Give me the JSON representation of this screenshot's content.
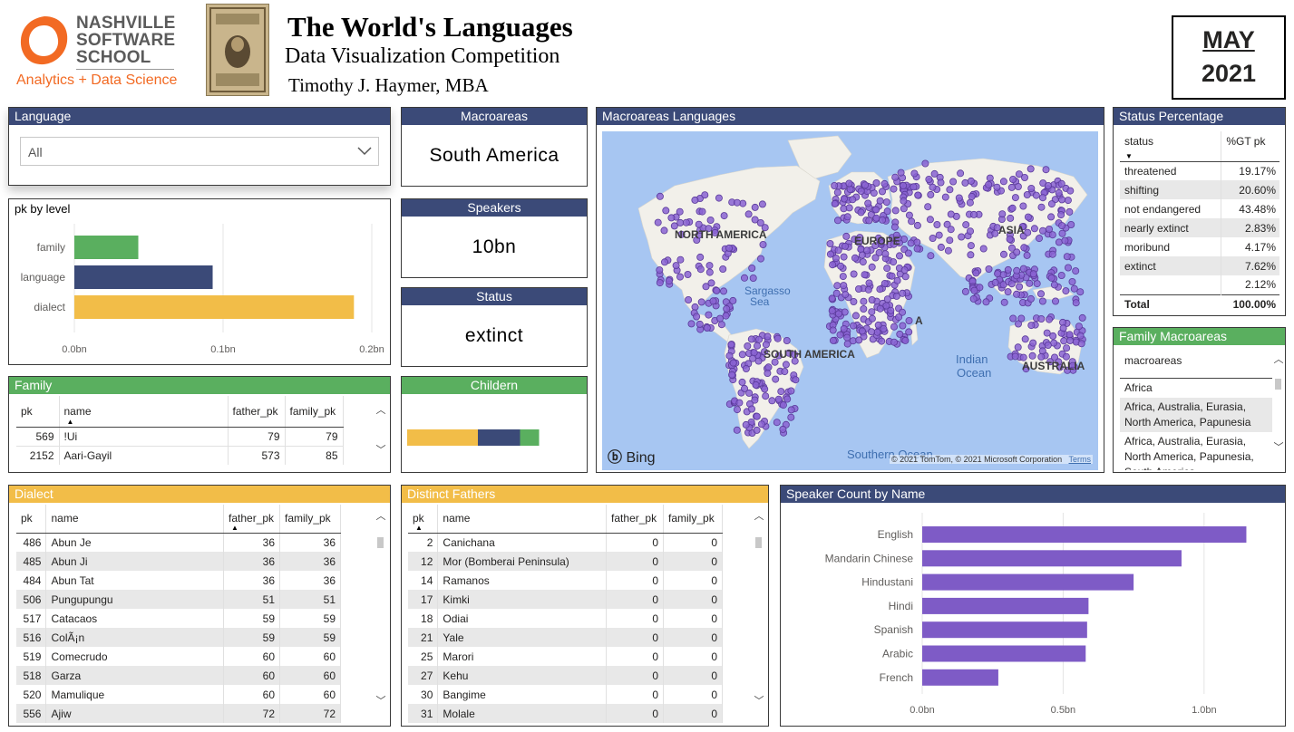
{
  "header": {
    "logo_line1": "NASHVILLE",
    "logo_line2": "SOFTWARE",
    "logo_line3": "SCHOOL",
    "logo_tagline": "Analytics + Data Science",
    "title": "The World's Languages",
    "subtitle": "Data Visualization Competition",
    "author": "Timothy J. Haymer, MBA",
    "month": "MAY",
    "year": "2021"
  },
  "language_slicer": {
    "title": "Language",
    "value": "All"
  },
  "kpis": {
    "macroareas": {
      "title": "Macroareas",
      "value": "South America"
    },
    "speakers": {
      "title": "Speakers",
      "value": "10bn"
    },
    "status": {
      "title": "Status",
      "value": "extinct"
    },
    "children": {
      "title": "Childern"
    }
  },
  "pk_by_level": {
    "title": "pk by level",
    "ticks": [
      "0.0bn",
      "0.1bn",
      "0.2bn"
    ]
  },
  "map": {
    "title": "Macroareas Languages",
    "labels": {
      "north_america": "NORTH AMERICA",
      "europe": "EUROPE",
      "asia": "ASIA",
      "south_america": "SOUTH AMERICA",
      "sargasso": "Sargasso",
      "sea": "Sea",
      "indian": "Indian",
      "ocean": "Ocean",
      "southern_ocean": "Southern Ocean",
      "africa": "A",
      "australia": "AUSTRALIA"
    },
    "bing": "Bing",
    "copyright": "© 2021 TomTom, © 2021 Microsoft Corporation",
    "terms": "Terms"
  },
  "status_percentage": {
    "title": "Status Percentage",
    "col1": "status",
    "col2": "%GT pk",
    "rows": [
      {
        "status": "threatened",
        "pct": "19.17%"
      },
      {
        "status": "shifting",
        "pct": "20.60%"
      },
      {
        "status": "not endangered",
        "pct": "43.48%"
      },
      {
        "status": "nearly extinct",
        "pct": "2.83%"
      },
      {
        "status": "moribund",
        "pct": "4.17%"
      },
      {
        "status": "extinct",
        "pct": "7.62%"
      },
      {
        "status": "",
        "pct": "2.12%"
      }
    ],
    "total_label": "Total",
    "total_value": "100.00%"
  },
  "family_macroareas": {
    "title": "Family Macroareas",
    "col": "macroareas",
    "rows": [
      "Africa",
      "Africa, Australia, Eurasia, North America, Papunesia",
      "Africa, Australia, Eurasia, North America, Papunesia, South America"
    ]
  },
  "family_table": {
    "title": "Family",
    "cols": [
      "pk",
      "name",
      "father_pk",
      "family_pk"
    ],
    "rows": [
      [
        "569",
        "!Ui",
        "79",
        "79"
      ],
      [
        "2152",
        "Aari-Gayil",
        "573",
        "85"
      ]
    ]
  },
  "dialect_table": {
    "title": "Dialect",
    "cols": [
      "pk",
      "name",
      "father_pk",
      "family_pk"
    ],
    "rows": [
      [
        "486",
        "Abun Je",
        "36",
        "36"
      ],
      [
        "485",
        "Abun Ji",
        "36",
        "36"
      ],
      [
        "484",
        "Abun Tat",
        "36",
        "36"
      ],
      [
        "506",
        "Pungupungu",
        "51",
        "51"
      ],
      [
        "517",
        "Catacaos",
        "59",
        "59"
      ],
      [
        "516",
        "ColÃ¡n",
        "59",
        "59"
      ],
      [
        "519",
        "Comecrudo",
        "60",
        "60"
      ],
      [
        "518",
        "Garza",
        "60",
        "60"
      ],
      [
        "520",
        "Mamulique",
        "60",
        "60"
      ],
      [
        "556",
        "Ajiw",
        "72",
        "72"
      ]
    ]
  },
  "fathers_table": {
    "title": "Distinct Fathers",
    "cols": [
      "pk",
      "name",
      "father_pk",
      "family_pk"
    ],
    "rows": [
      [
        "2",
        "Canichana",
        "0",
        "0"
      ],
      [
        "12",
        "Mor (Bomberai Peninsula)",
        "0",
        "0"
      ],
      [
        "14",
        "Ramanos",
        "0",
        "0"
      ],
      [
        "17",
        "Kimki",
        "0",
        "0"
      ],
      [
        "18",
        "Odiai",
        "0",
        "0"
      ],
      [
        "21",
        "Yale",
        "0",
        "0"
      ],
      [
        "25",
        "Marori",
        "0",
        "0"
      ],
      [
        "27",
        "Kehu",
        "0",
        "0"
      ],
      [
        "30",
        "Bangime",
        "0",
        "0"
      ],
      [
        "31",
        "Molale",
        "0",
        "0"
      ]
    ]
  },
  "chart_data": [
    {
      "type": "bar",
      "title": "pk by level",
      "orientation": "horizontal",
      "categories": [
        "family",
        "language",
        "dialect"
      ],
      "values": [
        0.043,
        0.093,
        0.188
      ],
      "colors": [
        "#5aaf5f",
        "#3b4a78",
        "#f2bd48"
      ],
      "xlim": [
        0,
        0.2
      ],
      "tick_labels": [
        "0.0bn",
        "0.1bn",
        "0.2bn"
      ],
      "grid": true
    },
    {
      "type": "bar",
      "title": "Speaker Count by Name",
      "orientation": "horizontal",
      "categories": [
        "English",
        "Mandarin Chinese",
        "Hindustani",
        "Hindi",
        "Spanish",
        "Arabic",
        "French"
      ],
      "values": [
        1.15,
        0.92,
        0.75,
        0.59,
        0.585,
        0.58,
        0.27
      ],
      "color": "#7e5bc6",
      "xlim": [
        0,
        1.2
      ],
      "tick_labels": [
        "0.0bn",
        "0.5bn",
        "1.0bn"
      ],
      "grid": true
    },
    {
      "type": "bar",
      "title": "Childern",
      "orientation": "stacked-horizontal",
      "categories": [
        "dialect",
        "language",
        "family"
      ],
      "values": [
        0.52,
        0.31,
        0.14
      ],
      "colors": [
        "#f2bd48",
        "#3b4a78",
        "#5aaf5f"
      ]
    }
  ],
  "colors": {
    "navy": "#3b4a78",
    "green": "#5aaf5f",
    "gold": "#f2bd48",
    "purple": "#7e5bc6",
    "orange": "#f26a23"
  }
}
